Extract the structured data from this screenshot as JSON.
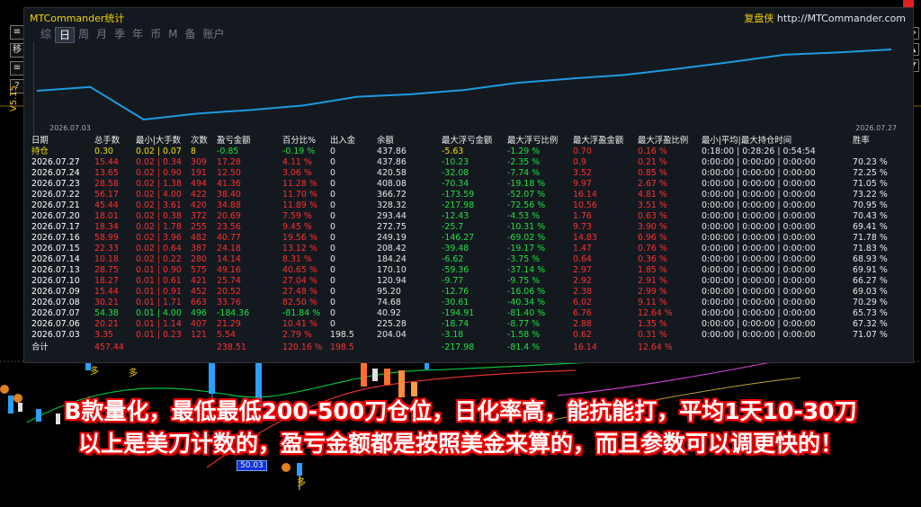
{
  "app": {
    "title": "MTCommander统计",
    "link_prefix": "复盘侠",
    "link_url": "http://MTCommander.com",
    "version": "V5.15"
  },
  "tabs": [
    "综",
    "日",
    "周",
    "月",
    "季",
    "年",
    "币",
    "M",
    "备",
    "账户"
  ],
  "active_tab": "日",
  "left_toolbar": [
    "≡",
    "移",
    "≡",
    "?"
  ],
  "chart": {
    "start_date": "2026.07.03",
    "end_date": "2026.07.27",
    "line_color": "#1e9ae0",
    "values": [
      437.86,
      420.58,
      408.08,
      366.72,
      328.32,
      293.44,
      272.75,
      249.19,
      208.42,
      184.24,
      170.1,
      120.94,
      95.2,
      74.68,
      40.92,
      225.28,
      204.04
    ]
  },
  "table": {
    "headers": [
      "日期",
      "总手数",
      "最小|大手数",
      "次数",
      "盈亏金额",
      "百分比%",
      "出入金",
      "余额",
      "最大浮亏金额",
      "最大浮亏比例",
      "最大浮盈金额",
      "最大浮盈比例",
      "最小|平均|最大持仓时间",
      "胜率"
    ],
    "holding": {
      "label": "持仓",
      "lots": "0.30",
      "minmax": "0.02 | 0.07",
      "count": "8",
      "pl": "-0.85",
      "pct": "-0.19 %",
      "io": "0",
      "balance": "437.86",
      "mfl": "-5.63",
      "mflp": "-1.29 %",
      "mfp": "0.70",
      "mfpp": "0.16 %",
      "time": "0:18:00 | 0:28:26 | 0:54:54",
      "win": ""
    },
    "rows": [
      {
        "date": "2026.07.27",
        "lots": "15.44",
        "minmax": "0.02 | 0.34",
        "count": "309",
        "pl": "17.28",
        "pct": "4.11 %",
        "io": "0",
        "balance": "437.86",
        "mfl": "-10.23",
        "mflp": "-2.35 %",
        "mfp": "0.9",
        "mfpp": "0.21 %",
        "time": "0:00:00 | 0:00:00 | 0:00:00",
        "win": "70.23 %",
        "pos": true
      },
      {
        "date": "2026.07.24",
        "lots": "13.65",
        "minmax": "0.02 | 0.90",
        "count": "191",
        "pl": "12.50",
        "pct": "3.06 %",
        "io": "0",
        "balance": "420.58",
        "mfl": "-32.08",
        "mflp": "-7.74 %",
        "mfp": "3.52",
        "mfpp": "0.85 %",
        "time": "0:00:00 | 0:00:00 | 0:00:00",
        "win": "72.25 %",
        "pos": true
      },
      {
        "date": "2026.07.23",
        "lots": "28.58",
        "minmax": "0.02 | 1.38",
        "count": "494",
        "pl": "41.36",
        "pct": "11.28 %",
        "io": "0",
        "balance": "408.08",
        "mfl": "-70.34",
        "mflp": "-19.18 %",
        "mfp": "9.97",
        "mfpp": "2.67 %",
        "time": "0:00:00 | 0:00:00 | 0:00:00",
        "win": "71.05 %",
        "pos": true
      },
      {
        "date": "2026.07.22",
        "lots": "56.17",
        "minmax": "0.02 | 4.00",
        "count": "422",
        "pl": "38.40",
        "pct": "11.70 %",
        "io": "0",
        "balance": "366.72",
        "mfl": "-173.59",
        "mflp": "-52.07 %",
        "mfp": "16.14",
        "mfpp": "4.81 %",
        "time": "0:00:00 | 0:00:00 | 0:00:00",
        "win": "73.22 %",
        "pos": true
      },
      {
        "date": "2026.07.21",
        "lots": "45.44",
        "minmax": "0.02 | 3.61",
        "count": "420",
        "pl": "34.88",
        "pct": "11.89 %",
        "io": "0",
        "balance": "328.32",
        "mfl": "-217.98",
        "mflp": "-72.56 %",
        "mfp": "10.56",
        "mfpp": "3.51 %",
        "time": "0:00:00 | 0:00:00 | 0:00:00",
        "win": "70.95 %",
        "pos": true
      },
      {
        "date": "2026.07.20",
        "lots": "18.01",
        "minmax": "0.02 | 0.38",
        "count": "372",
        "pl": "20.69",
        "pct": "7.59 %",
        "io": "0",
        "balance": "293.44",
        "mfl": "-12.43",
        "mflp": "-4.53 %",
        "mfp": "1.76",
        "mfpp": "0.63 %",
        "time": "0:00:00 | 0:00:00 | 0:00:00",
        "win": "70.43 %",
        "pos": true
      },
      {
        "date": "2026.07.17",
        "lots": "18.34",
        "minmax": "0.02 | 1.78",
        "count": "255",
        "pl": "23.56",
        "pct": "9.45 %",
        "io": "0",
        "balance": "272.75",
        "mfl": "-25.7",
        "mflp": "-10.31 %",
        "mfp": "9.73",
        "mfpp": "3.90 %",
        "time": "0:00:00 | 0:00:00 | 0:00:00",
        "win": "69.41 %",
        "pos": true
      },
      {
        "date": "2026.07.16",
        "lots": "58.99",
        "minmax": "0.02 | 3.96",
        "count": "482",
        "pl": "40.77",
        "pct": "19.56 %",
        "io": "0",
        "balance": "249.19",
        "mfl": "-146.27",
        "mflp": "-69.02 %",
        "mfp": "14.83",
        "mfpp": "6.96 %",
        "time": "0:00:00 | 0:00:00 | 0:00:00",
        "win": "71.78 %",
        "pos": true
      },
      {
        "date": "2026.07.15",
        "lots": "22.33",
        "minmax": "0.02 | 0.64",
        "count": "387",
        "pl": "24.18",
        "pct": "13.12 %",
        "io": "0",
        "balance": "208.42",
        "mfl": "-39.48",
        "mflp": "-19.17 %",
        "mfp": "1.47",
        "mfpp": "0.76 %",
        "time": "0:00:00 | 0:00:00 | 0:00:00",
        "win": "71.83 %",
        "pos": true
      },
      {
        "date": "2026.07.14",
        "lots": "10.18",
        "minmax": "0.02 | 0.22",
        "count": "280",
        "pl": "14.14",
        "pct": "8.31 %",
        "io": "0",
        "balance": "184.24",
        "mfl": "-6.62",
        "mflp": "-3.75 %",
        "mfp": "0.64",
        "mfpp": "0.36 %",
        "time": "0:00:00 | 0:00:00 | 0:00:00",
        "win": "68.93 %",
        "pos": true
      },
      {
        "date": "2026.07.13",
        "lots": "28.75",
        "minmax": "0.01 | 0.90",
        "count": "575",
        "pl": "49.16",
        "pct": "40.65 %",
        "io": "0",
        "balance": "170.10",
        "mfl": "-59.36",
        "mflp": "-37.14 %",
        "mfp": "2.97",
        "mfpp": "1.85 %",
        "time": "0:00:00 | 0:00:00 | 0:00:00",
        "win": "69.91 %",
        "pos": true
      },
      {
        "date": "2026.07.10",
        "lots": "18.27",
        "minmax": "0.01 | 0.61",
        "count": "421",
        "pl": "25.74",
        "pct": "27.04 %",
        "io": "0",
        "balance": "120.94",
        "mfl": "-9.77",
        "mflp": "-9.75 %",
        "mfp": "2.92",
        "mfpp": "2.91 %",
        "time": "0:00:00 | 0:00:00 | 0:00:00",
        "win": "66.27 %",
        "pos": true
      },
      {
        "date": "2026.07.09",
        "lots": "15.44",
        "minmax": "0.01 | 0.91",
        "count": "452",
        "pl": "20.52",
        "pct": "27.48 %",
        "io": "0",
        "balance": "95.20",
        "mfl": "-12.76",
        "mflp": "-16.06 %",
        "mfp": "2.38",
        "mfpp": "2.99 %",
        "time": "0:00:00 | 0:00:00 | 0:00:00",
        "win": "69.03 %",
        "pos": true
      },
      {
        "date": "2026.07.08",
        "lots": "30.21",
        "minmax": "0.01 | 1.71",
        "count": "663",
        "pl": "33.76",
        "pct": "82.50 %",
        "io": "0",
        "balance": "74.68",
        "mfl": "-30.61",
        "mflp": "-40.34 %",
        "mfp": "6.02",
        "mfpp": "9.11 %",
        "time": "0:00:00 | 0:00:00 | 0:00:00",
        "win": "70.29 %",
        "pos": true
      },
      {
        "date": "2026.07.07",
        "lots": "54.38",
        "minmax": "0.01 | 4.00",
        "count": "496",
        "pl": "-184.36",
        "pct": "-81.84 %",
        "io": "0",
        "balance": "40.92",
        "mfl": "-194.91",
        "mflp": "-81.40 %",
        "mfp": "6.76",
        "mfpp": "12.64 %",
        "time": "0:00:00 | 0:00:00 | 0:00:00",
        "win": "65.73 %",
        "pos": false
      },
      {
        "date": "2026.07.06",
        "lots": "20.21",
        "minmax": "0.01 | 1.14",
        "count": "407",
        "pl": "21.29",
        "pct": "10.41 %",
        "io": "0",
        "balance": "225.28",
        "mfl": "-18.74",
        "mflp": "-8.77 %",
        "mfp": "2.88",
        "mfpp": "1.35 %",
        "time": "0:00:00 | 0:00:00 | 0:00:00",
        "win": "67.32 %",
        "pos": true
      },
      {
        "date": "2026.07.03",
        "lots": "3.35",
        "minmax": "0.01 | 0.23",
        "count": "121",
        "pl": "5.54",
        "pct": "2.79 %",
        "io": "198.5",
        "balance": "204.04",
        "mfl": "-3.18",
        "mflp": "-1.58 %",
        "mfp": "0.62",
        "mfpp": "0.31 %",
        "time": "0:00:00 | 0:00:00 | 0:00:00",
        "win": "71.07 %",
        "pos": true
      }
    ],
    "total": {
      "label": "合计",
      "lots": "457.44",
      "pl": "238.51",
      "pct": "120.16 %",
      "io": "198.5",
      "mfl": "-217.98",
      "mflp": "-81.4 %",
      "mfp": "16.14",
      "mfpp": "12.64 %"
    }
  },
  "overlay_text": {
    "line1": "B款量化，最低最低200-500刀仓位，日化率高，能抗能打，平均1天10-30刀",
    "line2": "以上是美刀计数的，盈亏金额都是按照美金来算的，而且参数可以调更快的！"
  },
  "chart_labels": {
    "duo": "多",
    "price_box": "50.03"
  }
}
